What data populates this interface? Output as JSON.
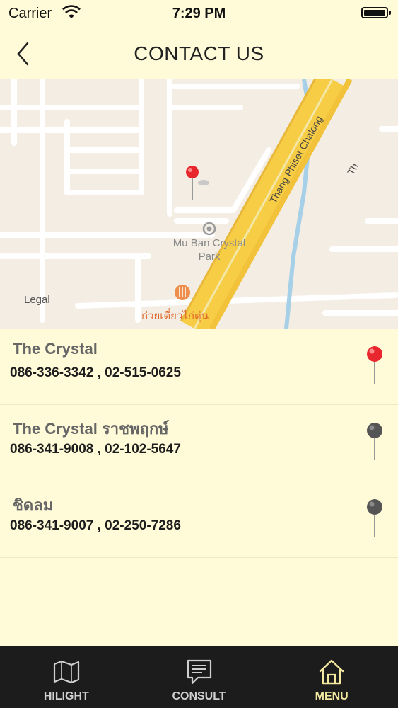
{
  "status_bar": {
    "carrier": "Carrier",
    "time": "7:29 PM"
  },
  "header": {
    "title": "CONTACT US"
  },
  "map": {
    "legal": "Legal",
    "place_label": "Mu Ban Crystal Park",
    "poi_label": "ก๋วยเตี๋ยวไก่ตุ๋น",
    "road_label": "Thang Phiset Chalong",
    "road_label_2": "Th"
  },
  "locations": [
    {
      "name": "The Crystal",
      "phones": "086-336-3342 , 02-515-0625",
      "pin_color": "#e8262d"
    },
    {
      "name": "The Crystal ราชพฤกษ์",
      "phones": "086-341-9008 , 02-102-5647",
      "pin_color": "#555555"
    },
    {
      "name": "ชิดลม",
      "phones": "086-341-9007 , 02-250-7286",
      "pin_color": "#555555"
    }
  ],
  "tab_bar": {
    "tabs": [
      {
        "label": "HILIGHT",
        "icon": "map-icon",
        "active": false
      },
      {
        "label": "CONSULT",
        "icon": "chat-icon",
        "active": false
      },
      {
        "label": "MENU",
        "icon": "home-icon",
        "active": true
      }
    ]
  },
  "colors": {
    "background": "#fffbd8",
    "tab_bar": "#1c1c1c",
    "active_tab": "#f3e8a0",
    "road_major": "#f7cd45"
  }
}
